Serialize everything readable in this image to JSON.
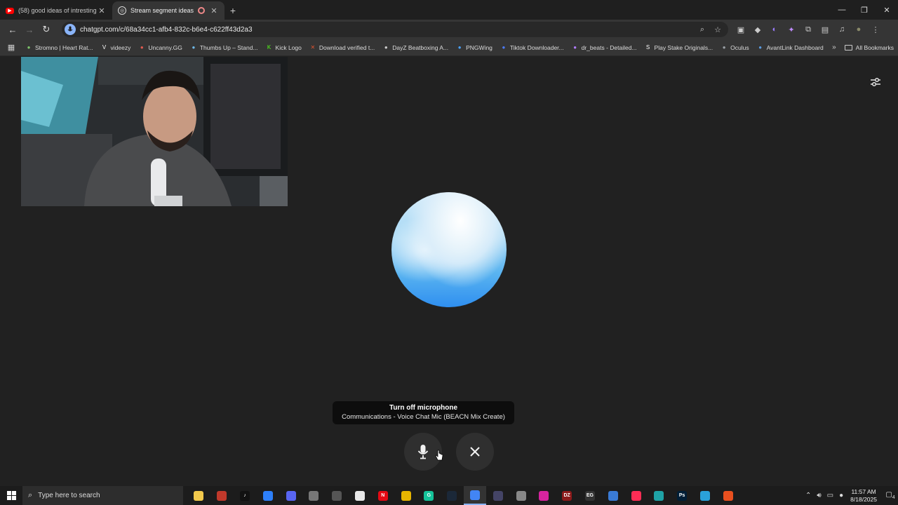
{
  "tabs": [
    {
      "title": "(58) good ideas of intresting int",
      "favicon": "youtube-icon",
      "active": false
    },
    {
      "title": "Stream segment ideas",
      "favicon": "chatgpt-icon",
      "active": true
    }
  ],
  "toolbar": {
    "url": "chatgpt.com/c/68a34cc1-afb4-832c-b6e4-c622ff43d2a3"
  },
  "bookmarks": [
    {
      "label": "Stromno | Heart Rat...",
      "color": "#7cc46a"
    },
    {
      "label": "videezy",
      "color": "#ffffff",
      "glyph": "V"
    },
    {
      "label": "Uncanny.GG",
      "color": "#e05a4f"
    },
    {
      "label": "Thumbs Up – Stand...",
      "color": "#6fb8e8"
    },
    {
      "label": "Kick Logo",
      "color": "#53fc18",
      "glyph": "K"
    },
    {
      "label": "Download verified t...",
      "color": "#e0532f",
      "glyph": "✕"
    },
    {
      "label": "DayZ Beatboxing A...",
      "color": "#cccccc"
    },
    {
      "label": "PNGWing",
      "color": "#4aa3ff"
    },
    {
      "label": "Tiktok Downloader...",
      "color": "#4d7cff"
    },
    {
      "label": "dr_beats - Detailed...",
      "color": "#b07cff"
    },
    {
      "label": "Play Stake Originals...",
      "color": "#ffffff",
      "glyph": "S"
    },
    {
      "label": "Oculus",
      "color": "#9aa0a6"
    },
    {
      "label": "AvantLink Dashboard",
      "color": "#5a9be0"
    }
  ],
  "bookmarks_all": "All Bookmarks",
  "voice": {
    "tooltip_title": "Turn off microphone",
    "tooltip_device": "Communications - Voice Chat Mic (BEACN Mix Create)"
  },
  "taskbar": {
    "search_placeholder": "Type here to search",
    "time": "11:57 AM",
    "date": "8/18/2025",
    "notifications": "4",
    "apps": [
      {
        "name": "file-explorer-icon",
        "color": "#f2c94c"
      },
      {
        "name": "app-red-circle-icon",
        "color": "#c0392b"
      },
      {
        "name": "tiktok-icon",
        "color": "#111111",
        "glyph": "♪"
      },
      {
        "name": "app-blue-icon",
        "color": "#2d7ff9"
      },
      {
        "name": "discord-icon",
        "color": "#5865f2"
      },
      {
        "name": "app-gray-icon",
        "color": "#777777"
      },
      {
        "name": "app-dial-icon",
        "color": "#555555"
      },
      {
        "name": "notepad-icon",
        "color": "#e8e8e8"
      },
      {
        "name": "netflix-icon",
        "color": "#e50914",
        "glyph": "N"
      },
      {
        "name": "app-pencil-icon",
        "color": "#e6b400"
      },
      {
        "name": "grammarly-icon",
        "color": "#15c39a",
        "glyph": "G"
      },
      {
        "name": "steam-icon",
        "color": "#1b2838"
      },
      {
        "name": "chrome-icon",
        "color": "#4285f4"
      },
      {
        "name": "app-ring-icon",
        "color": "#444466"
      },
      {
        "name": "app-target-icon",
        "color": "#888888"
      },
      {
        "name": "instagram-icon",
        "color": "#d6249f"
      },
      {
        "name": "dayz-icon",
        "color": "#8b1a1a",
        "glyph": "DZ"
      },
      {
        "name": "epic-games-icon",
        "color": "#333333",
        "glyph": "EG"
      },
      {
        "name": "app-window-icon",
        "color": "#3a7bd5"
      },
      {
        "name": "capcut-icon",
        "color": "#ff2d55"
      },
      {
        "name": "edge-icon",
        "color": "#1fa2a6"
      },
      {
        "name": "photoshop-icon",
        "color": "#001e36",
        "glyph": "Ps"
      },
      {
        "name": "telegram-icon",
        "color": "#2aa1da"
      },
      {
        "name": "app-orange-icon",
        "color": "#e8501f"
      }
    ]
  }
}
